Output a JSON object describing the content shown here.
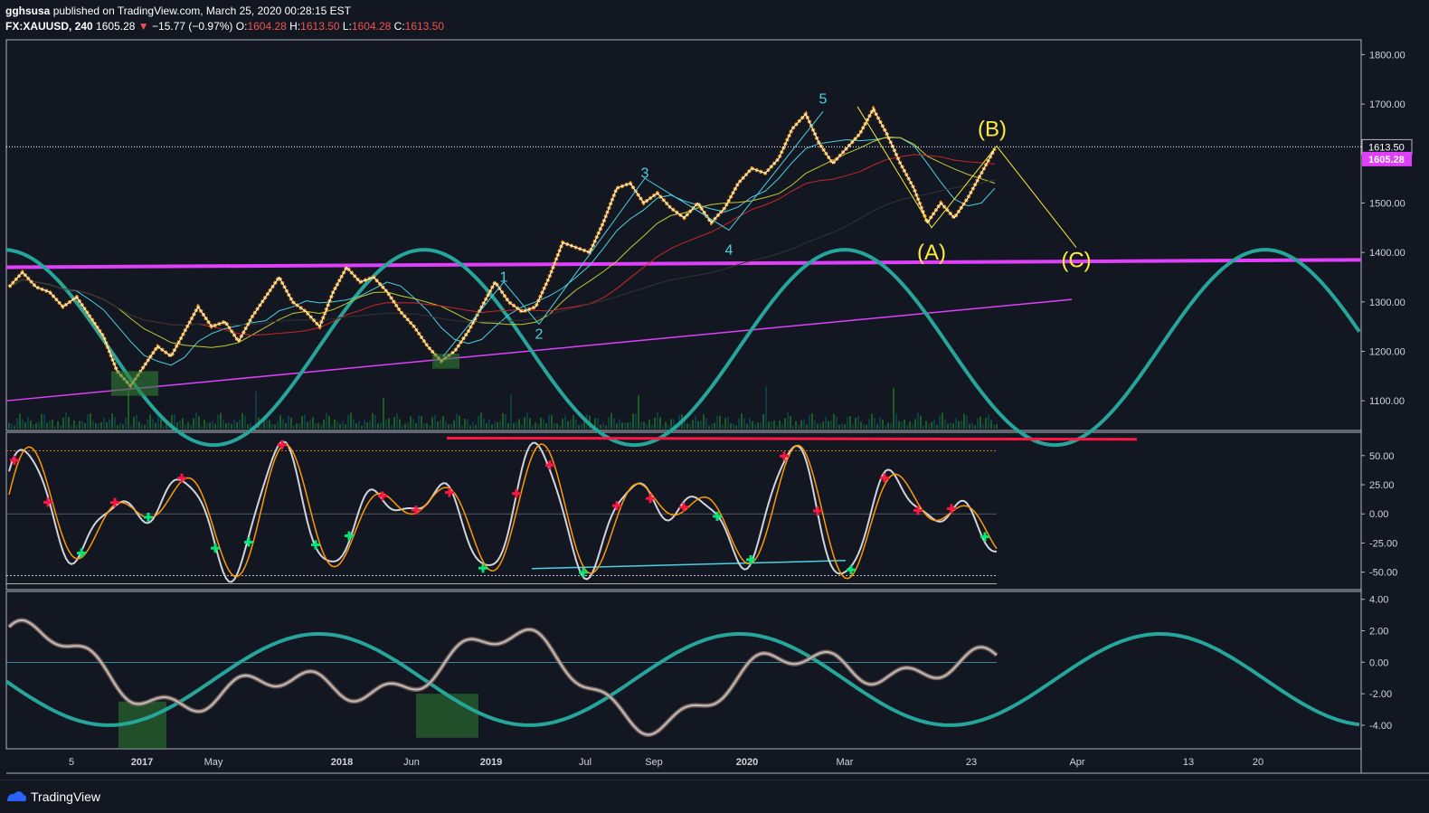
{
  "header": {
    "user": "gghsusa",
    "published": "published on TradingView.com, March 25, 2020 00:28:15 EST",
    "symbol": "FX:XAUUSD, 240",
    "last": "1605.28",
    "change": "−15.77 (−0.97%)",
    "o_label": "O:",
    "o": "1604.28",
    "h_label": "H:",
    "h": "1613.50",
    "l_label": "L:",
    "l": "1604.28",
    "c_label": "C:",
    "c": "1613.50"
  },
  "footer": {
    "brand": "TradingView"
  },
  "colors": {
    "background": "#131722",
    "magenta": "#e040fb",
    "teal": "#26a69a",
    "cyan": "#4dd0e1",
    "yellow": "#ffeb3b",
    "orange": "#ff9800",
    "red": "#ff1744",
    "green": "#00e676",
    "price_badge": "#e040fb"
  },
  "chart_data": [
    {
      "type": "line",
      "name": "price",
      "price_axis": {
        "ticks": [
          "1800.00",
          "1700.00",
          "1600.00",
          "1500.00",
          "1400.00",
          "1300.00",
          "1200.00",
          "1100.00"
        ],
        "ylim": [
          1040,
          1830
        ]
      },
      "last_price_label": "1613.50",
      "current_price_label": "1605.28",
      "x_labels": [
        "5",
        "2017",
        "May",
        "2018",
        "Jun",
        "2019",
        "Jul",
        "Sep",
        "2020",
        "Mar",
        "23",
        "Apr",
        "13",
        "20"
      ],
      "wave_labels": [
        {
          "text": "1",
          "price": 1350
        },
        {
          "text": "2",
          "price": 1235
        },
        {
          "text": "3",
          "price": 1560
        },
        {
          "text": "4",
          "price": 1405
        },
        {
          "text": "5",
          "price": 1710
        },
        {
          "text": "(A)",
          "price": 1400
        },
        {
          "text": "(B)",
          "price": 1650
        },
        {
          "text": "(C)",
          "price": 1385
        }
      ],
      "price_path": [
        1330,
        1360,
        1330,
        1320,
        1290,
        1310,
        1270,
        1230,
        1160,
        1130,
        1170,
        1210,
        1190,
        1240,
        1290,
        1250,
        1260,
        1220,
        1270,
        1310,
        1350,
        1300,
        1280,
        1250,
        1320,
        1370,
        1340,
        1350,
        1320,
        1280,
        1250,
        1210,
        1180,
        1200,
        1240,
        1290,
        1340,
        1300,
        1280,
        1290,
        1350,
        1420,
        1410,
        1400,
        1460,
        1530,
        1540,
        1500,
        1520,
        1490,
        1470,
        1500,
        1460,
        1490,
        1540,
        1570,
        1560,
        1590,
        1650,
        1680,
        1620,
        1580,
        1610,
        1640,
        1690,
        1640,
        1580,
        1530,
        1460,
        1500,
        1470,
        1510,
        1560,
        1610
      ]
    },
    {
      "type": "line",
      "name": "oscillator-1",
      "y_ticks": [
        "50.00",
        "25.00",
        "0.00",
        "-25.00",
        "-50.00"
      ],
      "ylim": [
        -65,
        70
      ]
    },
    {
      "type": "line",
      "name": "oscillator-2",
      "y_ticks": [
        "4.00",
        "2.00",
        "0.00",
        "-2.00",
        "-4.00"
      ],
      "ylim": [
        -5.5,
        4.5
      ]
    }
  ]
}
